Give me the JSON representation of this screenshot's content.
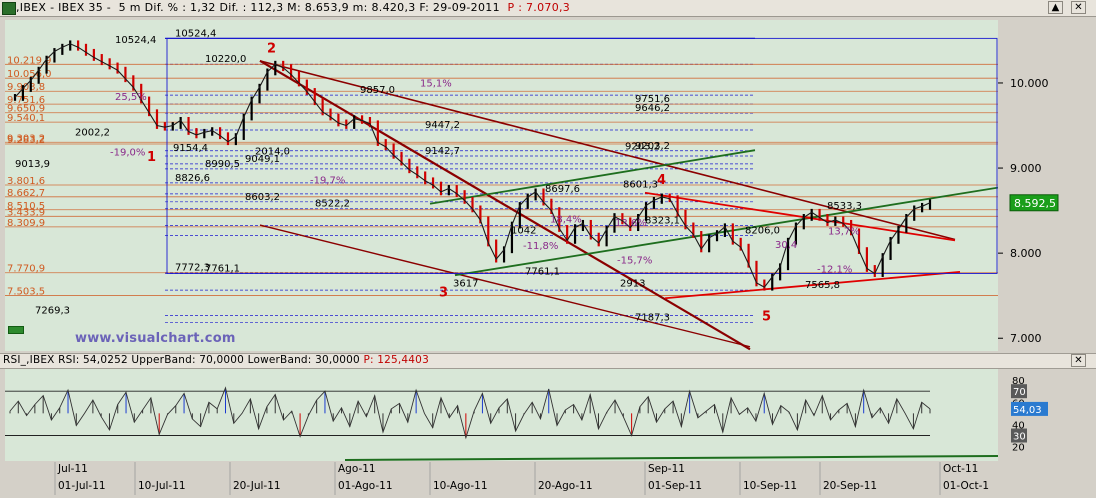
{
  "window": {
    "title_prefix": ",IBEX - IBEX 35 -  5 m Dif. % : 1,32 Dif. : 112,3 M: 8.653,9 m: 8.420,3 F: 29-09-2011",
    "title_p": "P : 7.070,3",
    "scroll_up": "▲",
    "close": "✕"
  },
  "watermark": "www.visualchart.com",
  "price_tag": "8.592,5",
  "rsi": {
    "header": "RSI_,IBEX RSI: 54,0252 UpperBand: 70,0000 LowerBand: 30,0000",
    "header_p": "P: 125,4403",
    "value_tag": "54,03",
    "band_upper_tag": "70",
    "band_lower_tag": "30",
    "axis_ticks": [
      "80",
      "60",
      "40",
      "20"
    ]
  },
  "colors": {
    "panel_bg": "#d8e7d7",
    "bull": "#000000",
    "bear": "#d00000",
    "trend_dark": "#8b0000",
    "channel_green": "#1e6e1e",
    "trend_red": "#e00000",
    "fib": "#d05a20",
    "blue": "#1a1ad0",
    "purple": "#8a2a8a"
  },
  "chart_data": {
    "type": "line",
    "title": ",IBEX - IBEX 35 - 5 m",
    "xlabel": "",
    "ylabel": "",
    "y_ticks": [
      "10.000",
      "9.000",
      "8.000",
      "7.000"
    ],
    "ylim": [
      6850,
      10740
    ],
    "x_ticks": [
      "01-Jul-11",
      "10-Jul-11",
      "20-Jul-11",
      "01-Ago-11",
      "10-Ago-11",
      "20-Ago-11",
      "01-Sep-11",
      "10-Sep-11",
      "20-Sep-11",
      "01-Oct-1"
    ],
    "month_labels": [
      "Jul-11",
      "Ago-11",
      "Sep-11",
      "Oct-11"
    ],
    "series": [
      {
        "name": "IBEX",
        "values": [
          9830,
          9935,
          10030,
          10150,
          10280,
          10370,
          10420,
          10460,
          10420,
          10360,
          10300,
          10250,
          10200,
          10150,
          10050,
          9950,
          9800,
          9650,
          9500,
          9480,
          9500,
          9560,
          9430,
          9390,
          9420,
          9440,
          9380,
          9310,
          9370,
          9600,
          9800,
          9950,
          10130,
          10220,
          10180,
          10100,
          10000,
          9900,
          9780,
          9660,
          9600,
          9530,
          9500,
          9580,
          9560,
          9520,
          9300,
          9250,
          9150,
          9070,
          8980,
          8920,
          8850,
          8800,
          8720,
          8760,
          8700,
          8620,
          8520,
          8390,
          8120,
          7930,
          8040,
          8330,
          8560,
          8660,
          8720,
          8600,
          8500,
          8290,
          8150,
          8300,
          8350,
          8200,
          8120,
          8280,
          8430,
          8380,
          8300,
          8420,
          8560,
          8620,
          8660,
          8640,
          8470,
          8320,
          8220,
          8050,
          8180,
          8230,
          8310,
          8140,
          8070,
          7870,
          7650,
          7600,
          7720,
          7840,
          8140,
          8320,
          8420,
          8480,
          8420,
          8360,
          8390,
          8350,
          8250,
          8030,
          7820,
          7760,
          7960,
          8150,
          8280,
          8420,
          8520,
          8550,
          8592
        ]
      }
    ],
    "rsi_values": [
      52,
      61,
      48,
      58,
      66,
      44,
      55,
      71,
      39,
      50,
      62,
      47,
      35,
      58,
      69,
      42,
      53,
      64,
      31,
      49,
      57,
      68,
      45,
      38,
      60,
      54,
      73,
      41,
      50,
      63,
      36,
      56,
      67,
      44,
      52,
      29,
      48,
      62,
      70,
      43,
      55,
      38,
      61,
      47,
      66,
      33,
      54,
      59,
      42,
      71,
      50,
      37,
      64,
      46,
      57,
      28,
      52,
      68,
      41,
      55,
      63,
      34,
      49,
      60,
      45,
      72,
      39,
      53,
      58,
      44,
      67,
      36,
      51,
      62,
      47,
      30,
      56,
      65,
      42,
      54,
      61,
      38,
      70,
      46,
      52,
      58,
      33,
      64,
      49,
      55,
      43,
      68,
      40,
      57,
      51,
      35,
      62,
      48,
      66,
      44,
      53,
      59,
      38,
      71,
      46,
      55,
      41,
      63,
      50,
      36,
      60,
      54
    ],
    "rsi_bands": [
      70,
      30
    ],
    "rsi_ylim": [
      7,
      90
    ],
    "levels": [
      {
        "value": 10524,
        "label": "10524,4",
        "kind": "blue"
      },
      {
        "value": 10220,
        "label": "10220,0",
        "kind": "h"
      },
      {
        "value": 9857,
        "label": "9857,0",
        "kind": "h"
      },
      {
        "value": 9751,
        "label": "9751,6",
        "kind": "h"
      },
      {
        "value": 9646,
        "label": "9646,2",
        "kind": "h"
      },
      {
        "value": 9447,
        "label": "9447,2",
        "kind": "h"
      },
      {
        "value": 9203,
        "label": "9203,2",
        "kind": "h"
      },
      {
        "value": 9142,
        "label": "9142,7",
        "kind": "h"
      },
      {
        "value": 9049,
        "label": "9049,1",
        "kind": "h"
      },
      {
        "value": 8990,
        "label": "8990,5",
        "kind": "h"
      },
      {
        "value": 8826,
        "label": "8826,6",
        "kind": "h"
      },
      {
        "value": 8697,
        "label": "8697,6",
        "kind": "h"
      },
      {
        "value": 8603,
        "label": "8603,2",
        "kind": "h"
      },
      {
        "value": 8522,
        "label": "8522,2",
        "kind": "h"
      },
      {
        "value": 8323,
        "label": "8323,1",
        "kind": "h"
      },
      {
        "value": 8206,
        "label": "8206,0",
        "kind": "h"
      },
      {
        "value": 7761,
        "label": "7761,1",
        "kind": "h"
      },
      {
        "value": 7772,
        "label": "7772,3",
        "kind": "h"
      },
      {
        "value": 7565,
        "label": "7565,8",
        "kind": "h"
      },
      {
        "value": 7269,
        "label": "7269,3",
        "kind": "h"
      },
      {
        "value": 7187,
        "label": "7187,3",
        "kind": "h"
      }
    ],
    "fib_levels": [
      "10.219,9",
      "10.056,0",
      "9.903,8",
      "9.751,6",
      "9.650,9",
      "9.540,1",
      "9.303,2",
      "9.283,2",
      "3.801,6",
      "8.662,7",
      "8.510,5",
      "3.433,9",
      "8.309,9",
      "7.770,9",
      "7.503,5"
    ],
    "wave_labels": [
      "1",
      "2",
      "3",
      "4",
      "5"
    ],
    "annotations": [
      "-19,0%",
      "25,5%",
      "-19,7%",
      "15,1%",
      "18,4%",
      "-11,8%",
      "-15,7%",
      "13,6%",
      "30,4",
      "-12,1%",
      "13,7%",
      "2002,2",
      "2014,0",
      "3617",
      "2913",
      "1042",
      "8533,3",
      "8601,3",
      "7761,1",
      "9154,4",
      "9013,9",
      "9203,2",
      "10524,4"
    ]
  }
}
